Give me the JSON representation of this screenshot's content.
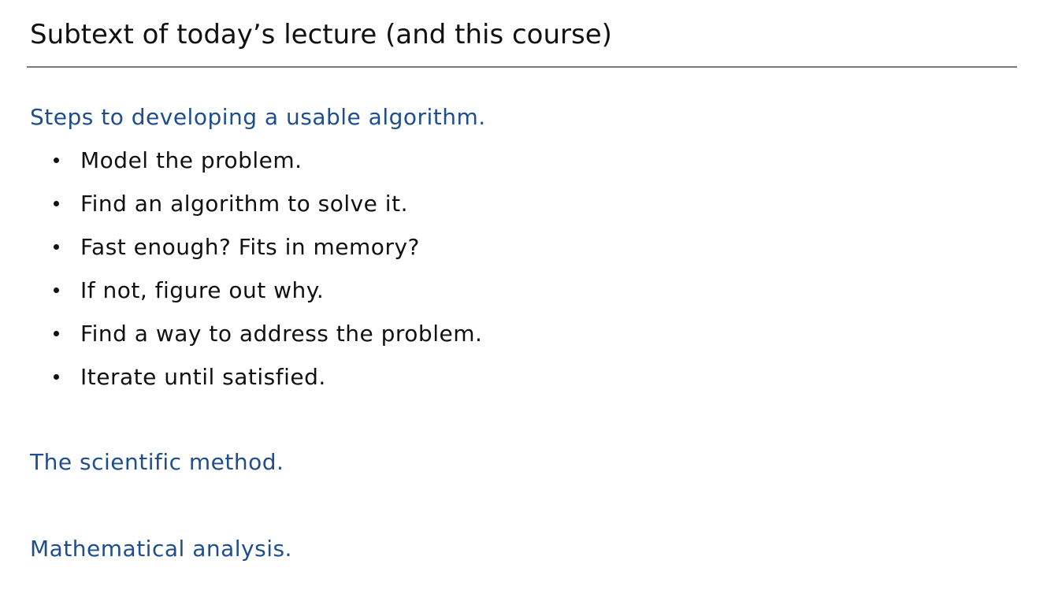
{
  "slide": {
    "title": "Subtext of today’s lecture (and this course)",
    "steps_heading": "Steps to developing a usable algorithm.",
    "steps": [
      "Model the problem.",
      "Find an algorithm to solve it.",
      "Fast enough? Fits in memory?",
      "If not, figure out why.",
      "Find a way to address the problem.",
      "Iterate until satisfied."
    ],
    "scientific_heading": "The scientific method.",
    "math_heading": "Mathematical analysis."
  },
  "colors": {
    "heading_blue": "#1f4e8c",
    "text": "#111111",
    "rule": "#7a7a7a",
    "background": "#ffffff"
  }
}
